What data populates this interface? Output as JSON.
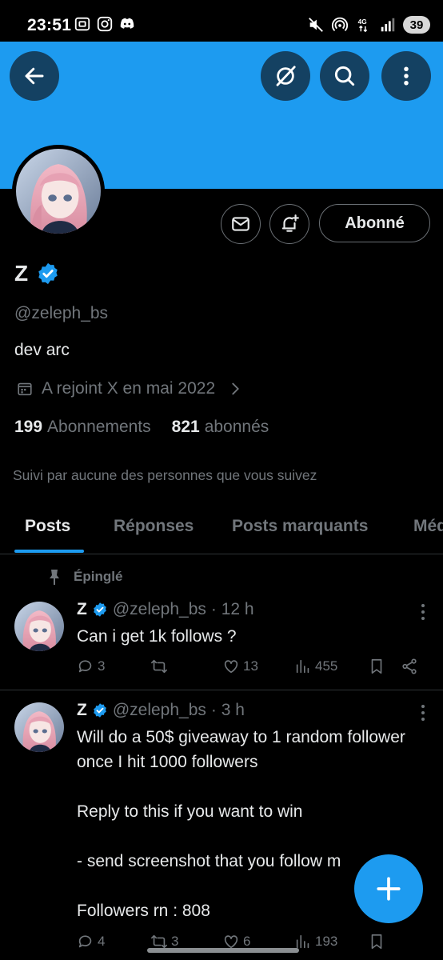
{
  "status_bar": {
    "time": "23:51",
    "battery": "39",
    "network": "4G",
    "app_icons": [
      "screenshot-icon",
      "instagram-icon",
      "discord-icon"
    ],
    "system_icons": [
      "mute-icon",
      "hotspot-icon",
      "signal-icon"
    ]
  },
  "colors": {
    "banner": "#1d9bf0",
    "accent": "#1d9bf0",
    "background": "#000000",
    "text_primary": "#e7e9ea",
    "text_secondary": "#71767b"
  },
  "top_bar": {
    "icons": [
      "back-arrow-icon",
      "grok-icon",
      "search-icon",
      "more-vertical-icon"
    ]
  },
  "profile": {
    "display_name": "Z",
    "handle": "@zeleph_bs",
    "bio": "dev arc",
    "joined": "A rejoint X en mai 2022",
    "following_count": "199",
    "following_label": "Abonnements",
    "followers_count": "821",
    "followers_label": "abonnés",
    "followed_by": "Suivi par aucune des personnes que vous suivez",
    "follow_button": "Abonné"
  },
  "tabs": [
    {
      "label": "Posts",
      "active": true
    },
    {
      "label": "Réponses",
      "active": false
    },
    {
      "label": "Posts marquants",
      "active": false
    },
    {
      "label": "Méd",
      "active": false
    }
  ],
  "pinned_label": "Épinglé",
  "tweets": [
    {
      "name": "Z",
      "handle": "@zeleph_bs",
      "time": "· 12 h",
      "text": "Can i get 1k follows ?",
      "replies": "3",
      "reposts": "",
      "likes": "13",
      "views": "455"
    },
    {
      "name": "Z",
      "handle": "@zeleph_bs",
      "time": "· 3 h",
      "text": "Will do a 50$ giveaway to 1 random follower once I hit 1000 followers\n\nReply to this if you want to win\n\n- send screenshot that you follow m\n\nFollowers rn : 808",
      "replies": "4",
      "reposts": "3",
      "likes": "6",
      "views": "193"
    }
  ]
}
